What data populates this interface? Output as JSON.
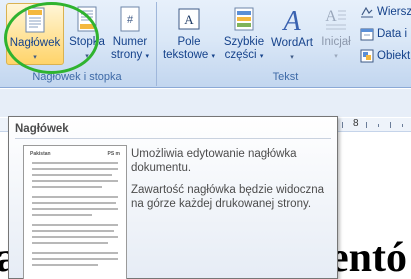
{
  "ribbon": {
    "header_footer_group": {
      "label": "Nagłówek i stopka",
      "buttons": [
        {
          "label": "Nagłówek",
          "icon": "header-page-icon"
        },
        {
          "label": "Stopka",
          "icon": "footer-page-icon"
        },
        {
          "label_line1": "Numer",
          "label_line2": "strony",
          "icon": "page-number-icon"
        }
      ]
    },
    "text_group": {
      "label": "Tekst",
      "buttons": [
        {
          "label_line1": "Pole",
          "label_line2": "tekstowe",
          "icon": "text-box-icon"
        },
        {
          "label_line1": "Szybkie",
          "label_line2": "części",
          "icon": "quick-parts-icon"
        },
        {
          "label": "WordArt",
          "icon": "wordart-icon"
        },
        {
          "label": "Inicjał",
          "icon": "drop-cap-icon",
          "disabled": true
        }
      ],
      "small_buttons": [
        {
          "label": "Wiersz",
          "icon": "signature-line-icon"
        },
        {
          "label": "Data i",
          "icon": "date-time-icon"
        },
        {
          "label": "Obiekt",
          "icon": "object-icon"
        }
      ]
    },
    "arrow": "▾"
  },
  "ruler": {
    "number": "8"
  },
  "tooltip": {
    "title": "Nagłówek",
    "description1": "Umożliwia edytowanie nagłówka dokumentu.",
    "description2": "Zawartość nagłówka będzie widoczna na górze każdej drukowanej strony.",
    "thumbnail_header_left": "Pakistan",
    "thumbnail_header_right": "PS m"
  },
  "document": {
    "visible_text_left": "a",
    "visible_text_right": "entó"
  },
  "colors": {
    "highlight": "#2fb32f",
    "ribbon_text": "#15428b"
  }
}
